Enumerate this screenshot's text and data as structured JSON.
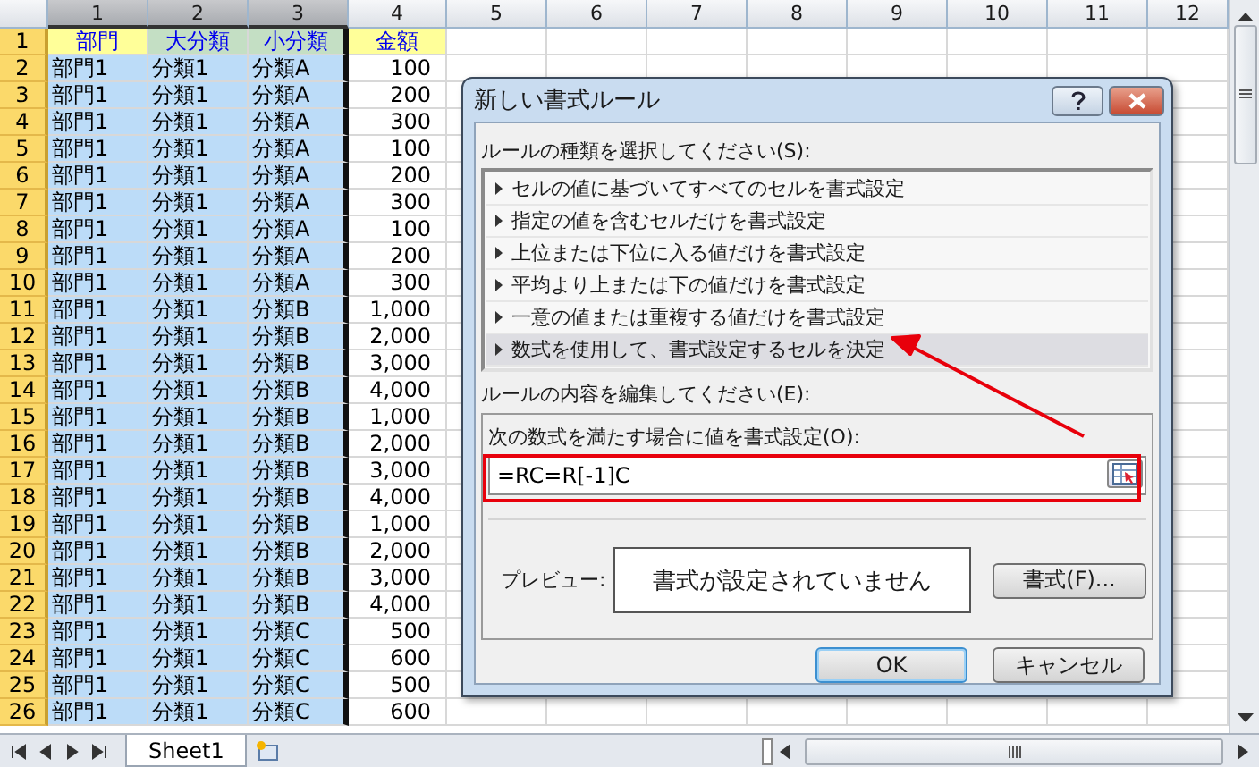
{
  "sheet": {
    "column_headers": [
      {
        "label": "1",
        "selected": true
      },
      {
        "label": "2",
        "selected": true
      },
      {
        "label": "3",
        "selected": true
      },
      {
        "label": "4",
        "selected": false
      },
      {
        "label": "5",
        "selected": false
      },
      {
        "label": "6",
        "selected": false
      },
      {
        "label": "7",
        "selected": false
      },
      {
        "label": "8",
        "selected": false
      },
      {
        "label": "9",
        "selected": false
      },
      {
        "label": "10",
        "selected": false
      },
      {
        "label": "11",
        "selected": false
      },
      {
        "label": "12",
        "selected": false
      }
    ],
    "rows": [
      {
        "header": "1",
        "selected": true,
        "cells": [
          {
            "text": "部門",
            "color": "#ffff99"
          },
          {
            "text": "大分類",
            "color": "#c4dfc4"
          },
          {
            "text": "小分類",
            "color": "#c4dfc4"
          },
          {
            "text": "金額",
            "color": "#ffff99"
          }
        ]
      },
      {
        "header": "2",
        "selected": true,
        "cells": [
          "部門1",
          "分類1",
          "分類A",
          "100"
        ]
      },
      {
        "header": "3",
        "selected": true,
        "cells": [
          "部門1",
          "分類1",
          "分類A",
          "200"
        ]
      },
      {
        "header": "4",
        "selected": true,
        "cells": [
          "部門1",
          "分類1",
          "分類A",
          "300"
        ]
      },
      {
        "header": "5",
        "selected": true,
        "cells": [
          "部門1",
          "分類1",
          "分類A",
          "100"
        ]
      },
      {
        "header": "6",
        "selected": true,
        "cells": [
          "部門1",
          "分類1",
          "分類A",
          "200"
        ]
      },
      {
        "header": "7",
        "selected": true,
        "cells": [
          "部門1",
          "分類1",
          "分類A",
          "300"
        ]
      },
      {
        "header": "8",
        "selected": true,
        "cells": [
          "部門1",
          "分類1",
          "分類A",
          "100"
        ]
      },
      {
        "header": "9",
        "selected": true,
        "cells": [
          "部門1",
          "分類1",
          "分類A",
          "200"
        ]
      },
      {
        "header": "10",
        "selected": true,
        "cells": [
          "部門1",
          "分類1",
          "分類A",
          "300"
        ]
      },
      {
        "header": "11",
        "selected": true,
        "cells": [
          "部門1",
          "分類1",
          "分類B",
          "1,000"
        ]
      },
      {
        "header": "12",
        "selected": true,
        "cells": [
          "部門1",
          "分類1",
          "分類B",
          "2,000"
        ]
      },
      {
        "header": "13",
        "selected": true,
        "cells": [
          "部門1",
          "分類1",
          "分類B",
          "3,000"
        ]
      },
      {
        "header": "14",
        "selected": true,
        "cells": [
          "部門1",
          "分類1",
          "分類B",
          "4,000"
        ]
      },
      {
        "header": "15",
        "selected": true,
        "cells": [
          "部門1",
          "分類1",
          "分類B",
          "1,000"
        ]
      },
      {
        "header": "16",
        "selected": true,
        "cells": [
          "部門1",
          "分類1",
          "分類B",
          "2,000"
        ]
      },
      {
        "header": "17",
        "selected": true,
        "cells": [
          "部門1",
          "分類1",
          "分類B",
          "3,000"
        ]
      },
      {
        "header": "18",
        "selected": true,
        "cells": [
          "部門1",
          "分類1",
          "分類B",
          "4,000"
        ]
      },
      {
        "header": "19",
        "selected": true,
        "cells": [
          "部門1",
          "分類1",
          "分類B",
          "1,000"
        ]
      },
      {
        "header": "20",
        "selected": true,
        "cells": [
          "部門1",
          "分類1",
          "分類B",
          "2,000"
        ]
      },
      {
        "header": "21",
        "selected": true,
        "cells": [
          "部門1",
          "分類1",
          "分類B",
          "3,000"
        ]
      },
      {
        "header": "22",
        "selected": true,
        "cells": [
          "部門1",
          "分類1",
          "分類B",
          "4,000"
        ]
      },
      {
        "header": "23",
        "selected": true,
        "cells": [
          "部門1",
          "分類1",
          "分類C",
          "500"
        ]
      },
      {
        "header": "24",
        "selected": true,
        "cells": [
          "部門1",
          "分類1",
          "分類C",
          "600"
        ]
      },
      {
        "header": "25",
        "selected": true,
        "cells": [
          "部門1",
          "分類1",
          "分類C",
          "500"
        ]
      },
      {
        "header": "26",
        "selected": true,
        "cells": [
          "部門1",
          "分類1",
          "分類C",
          "600"
        ]
      }
    ]
  },
  "sheet_tabs": [
    {
      "label": "Sheet1",
      "selected": true
    }
  ],
  "dialog": {
    "title": "新しい書式ルール",
    "rule_type_label": "ルールの種類を選択してください(S):",
    "rule_types": [
      {
        "label": "セルの値に基づいてすべてのセルを書式設定",
        "selected": false
      },
      {
        "label": "指定の値を含むセルだけを書式設定",
        "selected": false
      },
      {
        "label": "上位または下位に入る値だけを書式設定",
        "selected": false
      },
      {
        "label": "平均より上または下の値だけを書式設定",
        "selected": false
      },
      {
        "label": "一意の値または重複する値だけを書式設定",
        "selected": false
      },
      {
        "label": "数式を使用して、書式設定するセルを決定",
        "selected": true
      }
    ],
    "rule_edit_label": "ルールの内容を編集してください(E):",
    "formula_label": "次の数式を満たす場合に値を書式設定(O):",
    "formula_value": "=RC=R[-1]C",
    "preview_label": "プレビュー:",
    "preview_text": "書式が設定されていません",
    "format_button": "書式(F)...",
    "buttons": [
      {
        "label": "OK",
        "kind": "default"
      },
      {
        "label": "キャンセル",
        "kind": "normal"
      }
    ]
  }
}
